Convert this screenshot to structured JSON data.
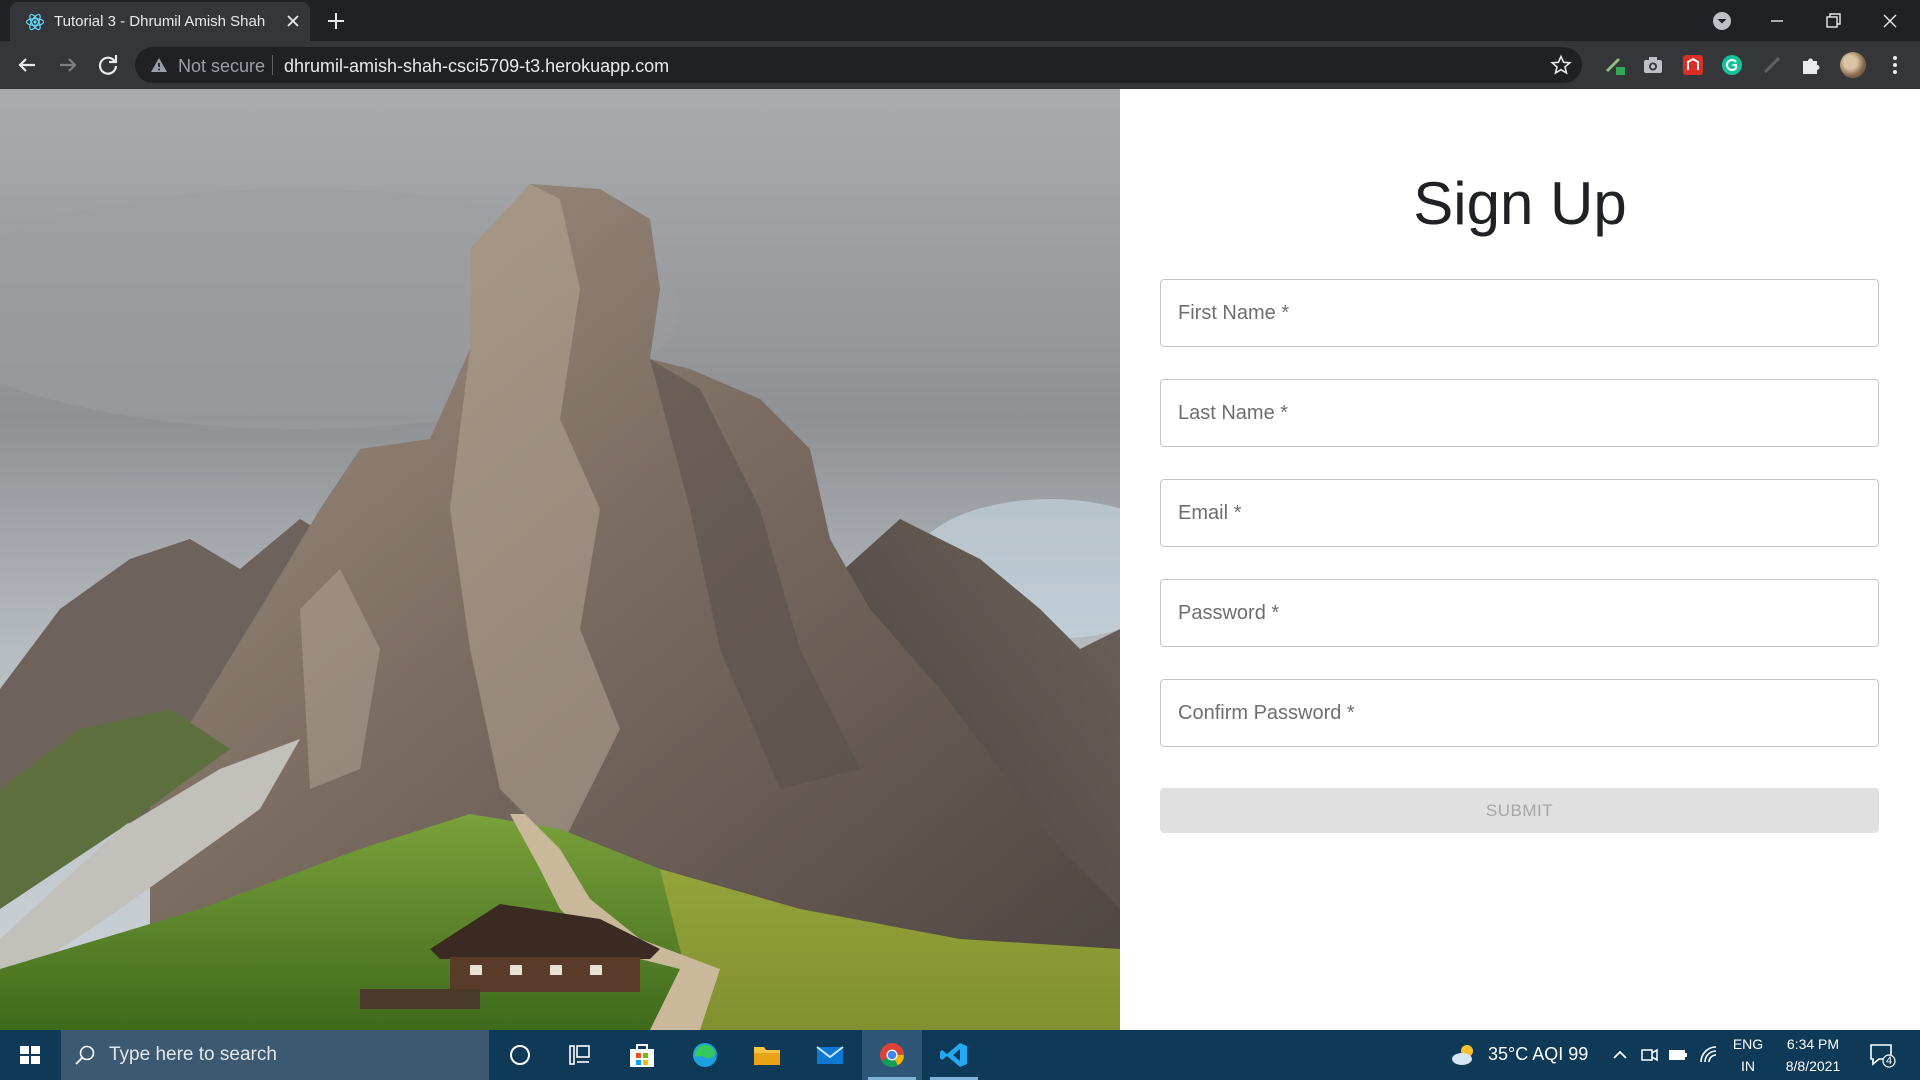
{
  "browser": {
    "tab_title": "Tutorial 3 - Dhrumil Amish Shah",
    "security_label": "Not secure",
    "url": "dhrumil-amish-shah-csci5709-t3.herokuapp.com"
  },
  "page": {
    "title": "Sign Up",
    "fields": [
      {
        "placeholder": "First Name *",
        "value": ""
      },
      {
        "placeholder": "Last Name *",
        "value": ""
      },
      {
        "placeholder": "Email *",
        "value": ""
      },
      {
        "placeholder": "Password *",
        "value": ""
      },
      {
        "placeholder": "Confirm Password *",
        "value": ""
      }
    ],
    "submit_label": "SUBMIT"
  },
  "taskbar": {
    "search_placeholder": "Type here to search",
    "apps": [
      "cortana-icon",
      "task-view-icon",
      "store-icon",
      "edge-icon",
      "file-explorer-icon",
      "mail-icon",
      "chrome-icon",
      "vscode-icon"
    ],
    "weather": "35°C  AQI 99",
    "language_top": "ENG",
    "language_bottom": "IN",
    "time": "6:34 PM",
    "date": "8/8/2021",
    "notification_count": "4"
  },
  "colors": {
    "tab_strip": "#202124",
    "toolbar": "#35363a",
    "taskbar": "#0e3a57",
    "submit_disabled": "#e0e0e0"
  }
}
